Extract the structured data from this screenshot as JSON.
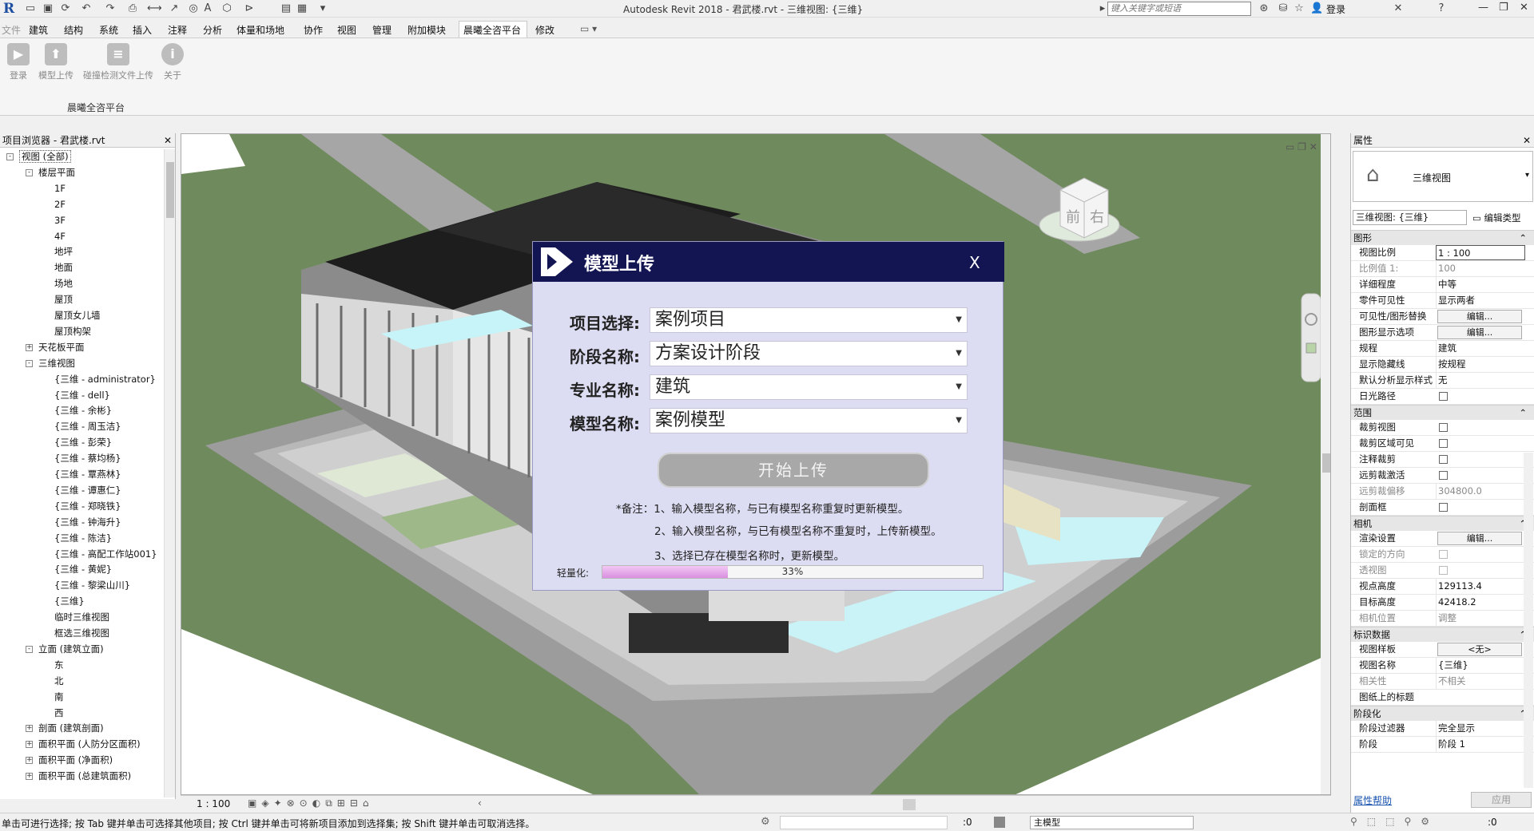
{
  "app": {
    "title": "Autodesk Revit 2018 -    君武楼.rvt - 三维视图: {三维}",
    "search_placeholder": "键入关键字或短语",
    "login": "登录"
  },
  "menu": {
    "items": [
      "文件",
      "建筑",
      "结构",
      "系统",
      "插入",
      "注释",
      "分析",
      "体量和场地",
      "协作",
      "视图",
      "管理",
      "附加模块",
      "晨曦全咨平台",
      "修改"
    ],
    "active_index": 12
  },
  "ribbon": {
    "buttons": [
      "登录",
      "模型上传",
      "碰撞检测文件上传",
      "关于"
    ],
    "panel_label": "晨曦全咨平台"
  },
  "browser": {
    "title": "项目浏览器 - 君武楼.rvt",
    "items": [
      {
        "level": 0,
        "toggle": "-",
        "label": "视图 (全部)"
      },
      {
        "level": 1,
        "toggle": "-",
        "label": "楼层平面"
      },
      {
        "level": 2,
        "label": "1F"
      },
      {
        "level": 2,
        "label": "2F"
      },
      {
        "level": 2,
        "label": "3F"
      },
      {
        "level": 2,
        "label": "4F"
      },
      {
        "level": 2,
        "label": "地坪"
      },
      {
        "level": 2,
        "label": "地面"
      },
      {
        "level": 2,
        "label": "场地"
      },
      {
        "level": 2,
        "label": "屋顶"
      },
      {
        "level": 2,
        "label": "屋顶女儿墙"
      },
      {
        "level": 2,
        "label": "屋顶构架"
      },
      {
        "level": 1,
        "toggle": "+",
        "label": "天花板平面"
      },
      {
        "level": 1,
        "toggle": "-",
        "label": "三维视图"
      },
      {
        "level": 2,
        "label": "{三维 - administrator}"
      },
      {
        "level": 2,
        "label": "{三维 - dell}"
      },
      {
        "level": 2,
        "label": "{三维 - 余彬}"
      },
      {
        "level": 2,
        "label": "{三维 - 周玉洁}"
      },
      {
        "level": 2,
        "label": "{三维 - 彭荣}"
      },
      {
        "level": 2,
        "label": "{三维 - 蔡均杨}"
      },
      {
        "level": 2,
        "label": "{三维 - 覃燕林}"
      },
      {
        "level": 2,
        "label": "{三维 - 谭惠仁}"
      },
      {
        "level": 2,
        "label": "{三维 - 郑晓铁}"
      },
      {
        "level": 2,
        "label": "{三维 - 钟海升}"
      },
      {
        "level": 2,
        "label": "{三维 - 陈洁}"
      },
      {
        "level": 2,
        "label": "{三维 - 高配工作站001}"
      },
      {
        "level": 2,
        "label": "{三维 - 黄妮}"
      },
      {
        "level": 2,
        "label": "{三维 - 黎梁山川}"
      },
      {
        "level": 2,
        "label": "{三维}"
      },
      {
        "level": 2,
        "label": "临时三维视图"
      },
      {
        "level": 2,
        "label": "框选三维视图"
      },
      {
        "level": 1,
        "toggle": "-",
        "label": "立面 (建筑立面)"
      },
      {
        "level": 2,
        "label": "东"
      },
      {
        "level": 2,
        "label": "北"
      },
      {
        "level": 2,
        "label": "南"
      },
      {
        "level": 2,
        "label": "西"
      },
      {
        "level": 1,
        "toggle": "+",
        "label": "剖面 (建筑剖面)"
      },
      {
        "level": 1,
        "toggle": "+",
        "label": "面积平面 (人防分区面积)"
      },
      {
        "level": 1,
        "toggle": "+",
        "label": "面积平面 (净面积)"
      },
      {
        "level": 1,
        "toggle": "+",
        "label": "面积平面 (总建筑面积)"
      }
    ]
  },
  "viewport": {
    "viewcube_faces": [
      "前",
      "右"
    ]
  },
  "viewbar": {
    "scale": "1 : 100"
  },
  "status": {
    "text": "单击可进行选择; 按 Tab 键并单击可选择其他项目; 按 Ctrl 键并单击可将新项目添加到选择集; 按 Shift 键并单击可取消选择。",
    "count_a": ":0",
    "model": "主模型",
    "count_b": ":0"
  },
  "properties": {
    "title": "属性",
    "type_name": "三维视图",
    "instance_select": "三维视图: {三维}",
    "edit_type": "编辑类型",
    "help": "属性帮助",
    "apply": "应用",
    "sections": [
      {
        "name": "图形",
        "rows": [
          {
            "k": "视图比例",
            "v": "1 : 100",
            "kind": "input"
          },
          {
            "k": "比例值 1:",
            "v": "100",
            "dis": true
          },
          {
            "k": "详细程度",
            "v": "中等"
          },
          {
            "k": "零件可见性",
            "v": "显示两者"
          },
          {
            "k": "可见性/图形替换",
            "v": "编辑...",
            "kind": "btn"
          },
          {
            "k": "图形显示选项",
            "v": "编辑...",
            "kind": "btn"
          },
          {
            "k": "规程",
            "v": "建筑"
          },
          {
            "k": "显示隐藏线",
            "v": "按规程"
          },
          {
            "k": "默认分析显示样式",
            "v": "无"
          },
          {
            "k": "日光路径",
            "v": "",
            "kind": "chk"
          }
        ]
      },
      {
        "name": "范围",
        "rows": [
          {
            "k": "裁剪视图",
            "v": "",
            "kind": "chk"
          },
          {
            "k": "裁剪区域可见",
            "v": "",
            "kind": "chk"
          },
          {
            "k": "注释裁剪",
            "v": "",
            "kind": "chk"
          },
          {
            "k": "远剪裁激活",
            "v": "",
            "kind": "chk"
          },
          {
            "k": "远剪裁偏移",
            "v": "304800.0",
            "dis": true
          },
          {
            "k": "剖面框",
            "v": "",
            "kind": "chk"
          }
        ]
      },
      {
        "name": "相机",
        "rows": [
          {
            "k": "渲染设置",
            "v": "编辑...",
            "kind": "btn"
          },
          {
            "k": "锁定的方向",
            "v": "",
            "kind": "chk",
            "dis": true
          },
          {
            "k": "透视图",
            "v": "",
            "kind": "chk",
            "dis": true
          },
          {
            "k": "视点高度",
            "v": "129113.4"
          },
          {
            "k": "目标高度",
            "v": "42418.2"
          },
          {
            "k": "相机位置",
            "v": "调整",
            "dis": true
          }
        ]
      },
      {
        "name": "标识数据",
        "rows": [
          {
            "k": "视图样板",
            "v": "<无>",
            "kind": "btn"
          },
          {
            "k": "视图名称",
            "v": "{三维}"
          },
          {
            "k": "相关性",
            "v": "不相关",
            "dis": true
          },
          {
            "k": "图纸上的标题",
            "v": ""
          }
        ]
      },
      {
        "name": "阶段化",
        "rows": [
          {
            "k": "阶段过滤器",
            "v": "完全显示"
          },
          {
            "k": "阶段",
            "v": "阶段 1"
          }
        ]
      }
    ]
  },
  "dialog": {
    "title": "模型上传",
    "close": "X",
    "fields": [
      {
        "label": "项目选择:",
        "value": "案例项目"
      },
      {
        "label": "阶段名称:",
        "value": "方案设计阶段"
      },
      {
        "label": "专业名称:",
        "value": "建筑"
      },
      {
        "label": "模型名称:",
        "value": "案例模型"
      }
    ],
    "upload_button": "开始上传",
    "notes": [
      "*备注：1、输入模型名称，与已有模型名称重复时更新模型。",
      "2、输入模型名称，与已有模型名称不重复时，上传新模型。",
      "3、选择已存在模型名称时，更新模型。"
    ],
    "progress_label": "轻量化:",
    "progress_value": 33,
    "progress_text": "33%"
  },
  "colors": {
    "dialog_header": "#131553",
    "dialog_bg": "#dcdcf2",
    "ground": "#6f8a5d",
    "road": "#a6a6a6",
    "progress": "#d98fe0"
  }
}
